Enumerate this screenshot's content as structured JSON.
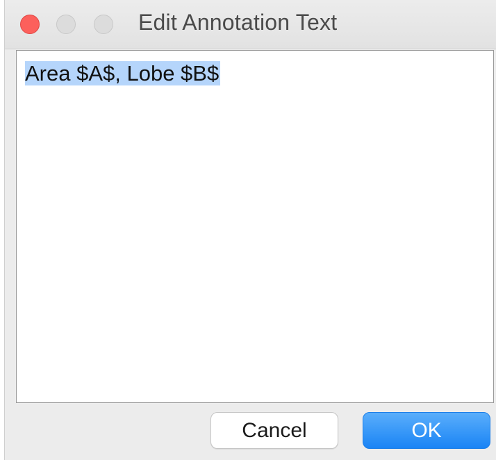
{
  "window": {
    "title": "Edit Annotation Text"
  },
  "editor": {
    "text": "Area $A$, Lobe $B$",
    "selection_color": "#b5d5fb"
  },
  "buttons": {
    "cancel_label": "Cancel",
    "ok_label": "OK"
  },
  "colors": {
    "close": "#fc605c",
    "ok_button": "#1a84f5"
  },
  "icons": {
    "close": "close-icon",
    "minimize": "minimize-icon",
    "zoom": "zoom-icon"
  }
}
